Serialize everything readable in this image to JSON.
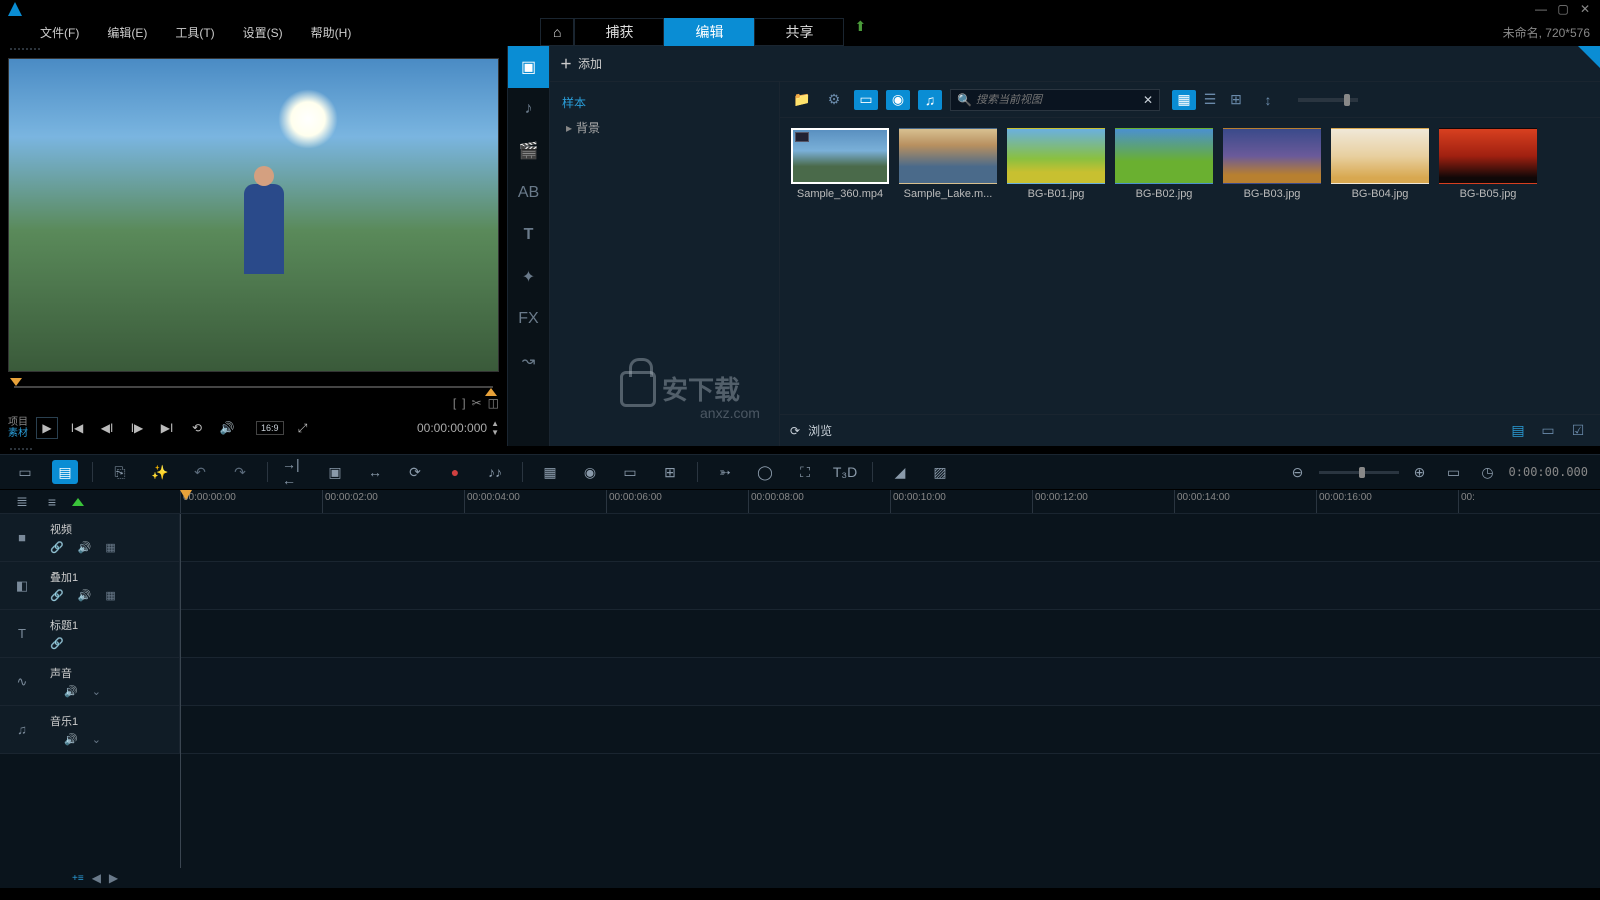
{
  "menu": {
    "file": "文件(F)",
    "edit": "编辑(E)",
    "tools": "工具(T)",
    "settings": "设置(S)",
    "help": "帮助(H)"
  },
  "modes": {
    "capture": "捕获",
    "edit": "编辑",
    "share": "共享"
  },
  "status": {
    "title": "未命名",
    "res": "720*576"
  },
  "preview": {
    "project": "项目",
    "clip": "素材",
    "aspect": "16:9",
    "timecode": "00:00:00:000"
  },
  "scrub": {
    "markin": "[",
    "markout": "]"
  },
  "library": {
    "add": "添加",
    "tree": {
      "samples": "样本",
      "background": "背景"
    },
    "search_placeholder": "搜索当前视图",
    "browse": "浏览",
    "items": [
      {
        "label": "Sample_360.mp4",
        "bg": "linear-gradient(180deg,#5a90c0 0%,#7ab0d8 40%,#4a6a4a 70%)",
        "sel": true
      },
      {
        "label": "Sample_Lake.m...",
        "bg": "linear-gradient(180deg,#d8c090 0%,#b89060 30%,#4a6a8a 70%)"
      },
      {
        "label": "BG-B01.jpg",
        "bg": "linear-gradient(180deg,#6ab0e0 0%,#8ac040 55%,#c8c030 80%)"
      },
      {
        "label": "BG-B02.jpg",
        "bg": "linear-gradient(180deg,#4a90d0 0%,#6ab030 60%)"
      },
      {
        "label": "BG-B03.jpg",
        "bg": "linear-gradient(180deg,#3a4a8a 0%,#6a5a9a 50%,#b88030 85%)"
      },
      {
        "label": "BG-B04.jpg",
        "bg": "linear-gradient(180deg,#f0e8d8 0%,#e8d0a0 50%,#d8a850 90%)"
      },
      {
        "label": "BG-B05.jpg",
        "bg": "linear-gradient(180deg,#d84020 0%,#a02010 50%,#100808 90%)"
      }
    ]
  },
  "timeline": {
    "timecode": "0:00:00.000",
    "marks": [
      "00:00:00:00",
      "00:00:02:00",
      "00:00:04:00",
      "00:00:06:00",
      "00:00:08:00",
      "00:00:10:00",
      "00:00:12:00",
      "00:00:14:00",
      "00:00:16:00",
      "00:"
    ]
  },
  "tracks": [
    {
      "icon": "■",
      "name": "视频",
      "ctrls": [
        "🔗",
        "🔊",
        "▦"
      ]
    },
    {
      "icon": "◧",
      "name": "叠加1",
      "ctrls": [
        "🔗",
        "🔊",
        "▦"
      ]
    },
    {
      "icon": "T",
      "name": "标题1",
      "ctrls": [
        "🔗"
      ]
    },
    {
      "icon": "∿",
      "name": "声音",
      "ctrls": [
        "",
        "🔊",
        "⌄"
      ]
    },
    {
      "icon": "♫",
      "name": "音乐1",
      "ctrls": [
        "",
        "🔊",
        "⌄"
      ]
    }
  ],
  "fx_label": "FX",
  "t3d_label": "T₃D"
}
